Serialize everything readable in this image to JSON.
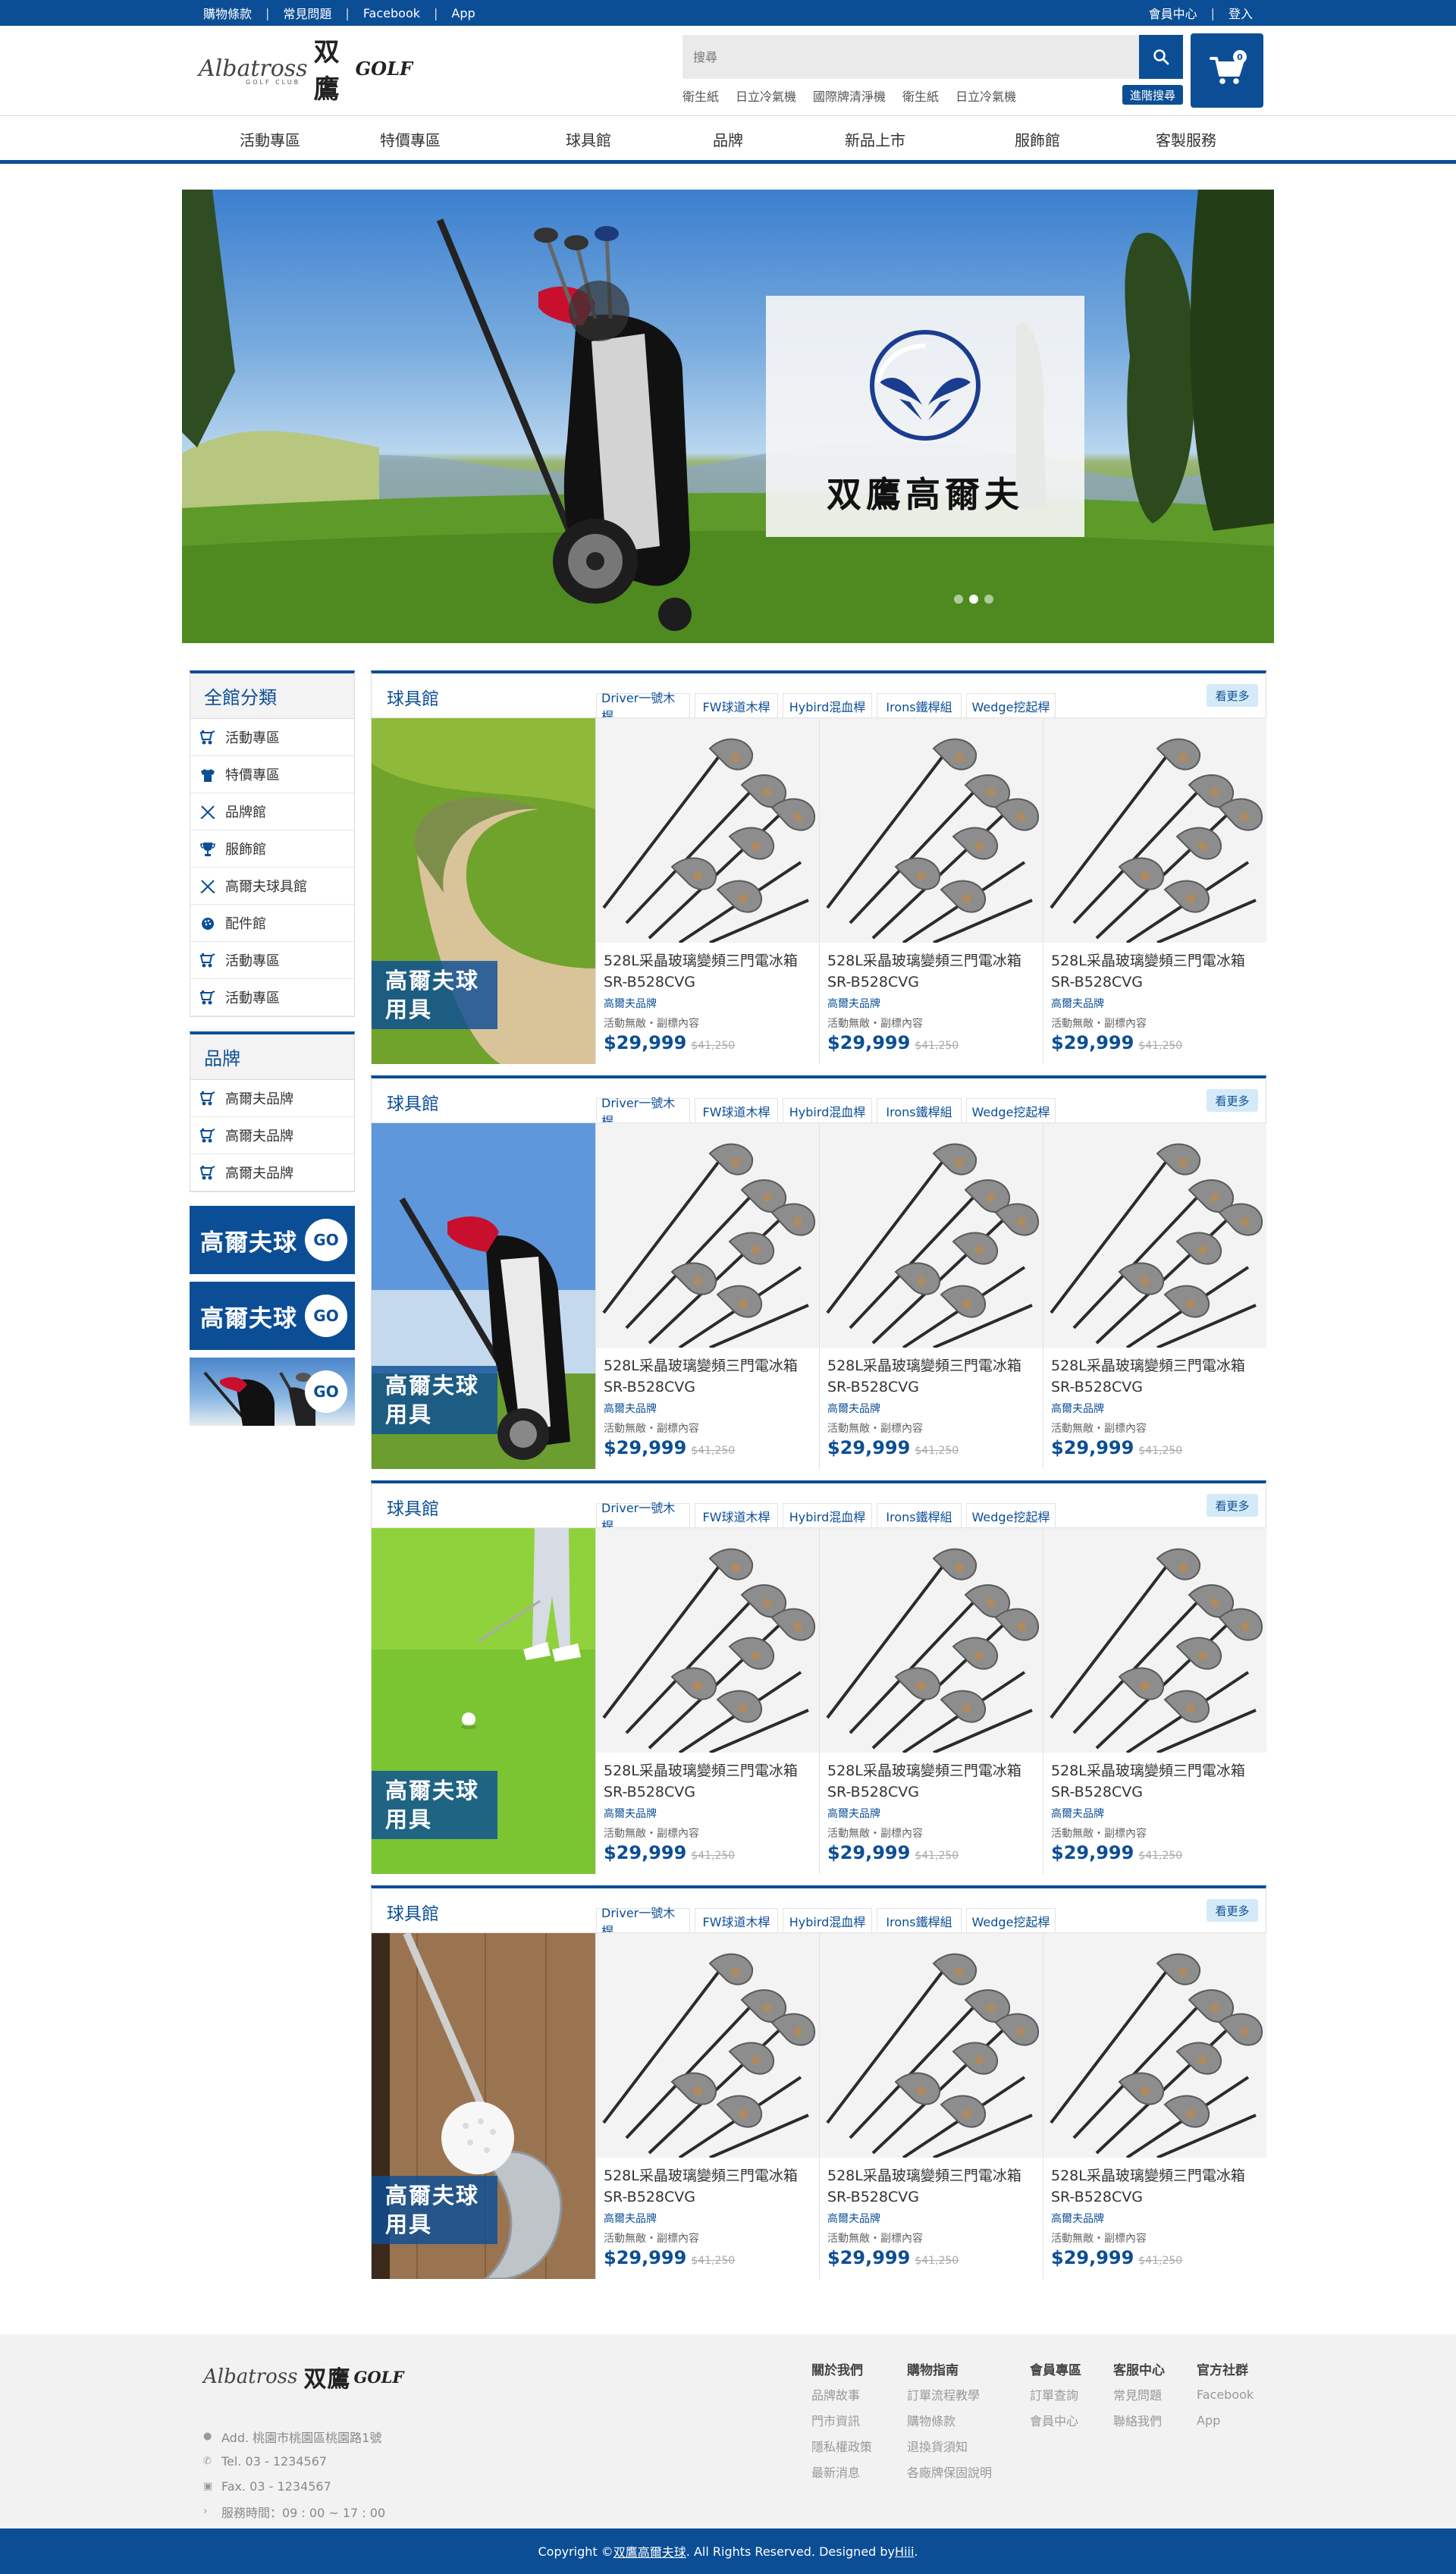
{
  "colors": {
    "primary": "#0c4e96",
    "accent_light": "#d5eaf8",
    "footer_bg": "#f2f2f2"
  },
  "topbar": {
    "left_links": [
      "購物條款",
      "常見問題",
      "Facebook",
      "App"
    ],
    "right_links": [
      "會員中心",
      "登入"
    ]
  },
  "header": {
    "logo_script": "Albatross",
    "logo_sub": "GOLF CLUB",
    "logo_cn": "双鷹",
    "logo_golf": "GOLF",
    "search_placeholder": "搜尋",
    "hot_keywords": [
      "衛生紙",
      "日立冷氣機",
      "國際牌清淨機",
      "衛生紙",
      "日立冷氣機"
    ],
    "advanced_search": "進階搜尋",
    "cart_count": "0"
  },
  "nav": [
    "活動專區",
    "特價專區",
    "球具館",
    "品牌",
    "新品上市",
    "服飾館",
    "客製服務"
  ],
  "banner": {
    "brand_cn": "双鷹高爾夫",
    "slide_count": 3,
    "active_slide": 2
  },
  "sidebar": {
    "categories_title": "全館分類",
    "categories": [
      {
        "label": "活動專區",
        "icon": "golf-cart-icon"
      },
      {
        "label": "特價專區",
        "icon": "shirt-icon"
      },
      {
        "label": "品牌館",
        "icon": "crossed-clubs-icon"
      },
      {
        "label": "服飾館",
        "icon": "trophy-icon"
      },
      {
        "label": "高爾夫球具館",
        "icon": "crossed-clubs-icon"
      },
      {
        "label": "配件館",
        "icon": "golf-ball-icon"
      },
      {
        "label": "活動專區",
        "icon": "golf-cart-icon"
      },
      {
        "label": "活動專區",
        "icon": "golf-cart-icon"
      }
    ],
    "brands_title": "品牌",
    "brands": [
      {
        "label": "高爾夫品牌",
        "icon": "golf-cart-icon"
      },
      {
        "label": "高爾夫品牌",
        "icon": "golf-cart-icon"
      },
      {
        "label": "高爾夫品牌",
        "icon": "golf-cart-icon"
      }
    ],
    "promos": [
      {
        "text": "高爾夫球",
        "go": "GO"
      },
      {
        "text": "高爾夫球",
        "go": "GO"
      },
      {
        "text": "",
        "go": "GO"
      }
    ]
  },
  "sections": [
    {
      "title": "球具館",
      "tabs": [
        "Driver一號木桿",
        "FW球道木桿",
        "Hybird混血桿",
        "Irons鐵桿組",
        "Wedge挖起桿"
      ],
      "more": "看更多",
      "feature_label": [
        "高爾夫球",
        "用具"
      ],
      "feature_scene": "bunker",
      "products": [
        {
          "name": "528L采晶玻璃變頻三門電冰箱 SR-B528CVG",
          "brand": "高爾夫品牌",
          "desc": "活動無敵・副標內容",
          "price": "$29,999",
          "old_price": "$41,250"
        },
        {
          "name": "528L采晶玻璃變頻三門電冰箱 SR-B528CVG",
          "brand": "高爾夫品牌",
          "desc": "活動無敵・副標內容",
          "price": "$29,999",
          "old_price": "$41,250"
        },
        {
          "name": "528L采晶玻璃變頻三門電冰箱 SR-B528CVG",
          "brand": "高爾夫品牌",
          "desc": "活動無敵・副標內容",
          "price": "$29,999",
          "old_price": "$41,250"
        }
      ]
    },
    {
      "title": "球具館",
      "tabs": [
        "Driver一號木桿",
        "FW球道木桿",
        "Hybird混血桿",
        "Irons鐵桿組",
        "Wedge挖起桿"
      ],
      "more": "看更多",
      "feature_label": [
        "高爾夫球",
        "用具"
      ],
      "feature_scene": "bag",
      "products": [
        {
          "name": "528L采晶玻璃變頻三門電冰箱 SR-B528CVG",
          "brand": "高爾夫品牌",
          "desc": "活動無敵・副標內容",
          "price": "$29,999",
          "old_price": "$41,250"
        },
        {
          "name": "528L采晶玻璃變頻三門電冰箱 SR-B528CVG",
          "brand": "高爾夫品牌",
          "desc": "活動無敵・副標內容",
          "price": "$29,999",
          "old_price": "$41,250"
        },
        {
          "name": "528L采晶玻璃變頻三門電冰箱 SR-B528CVG",
          "brand": "高爾夫品牌",
          "desc": "活動無敵・副標內容",
          "price": "$29,999",
          "old_price": "$41,250"
        }
      ]
    },
    {
      "title": "球具館",
      "tabs": [
        "Driver一號木桿",
        "FW球道木桿",
        "Hybird混血桿",
        "Irons鐵桿組",
        "Wedge挖起桿"
      ],
      "more": "看更多",
      "feature_label": [
        "高爾夫球",
        "用具"
      ],
      "feature_scene": "green",
      "products": [
        {
          "name": "528L采晶玻璃變頻三門電冰箱 SR-B528CVG",
          "brand": "高爾夫品牌",
          "desc": "活動無敵・副標內容",
          "price": "$29,999",
          "old_price": "$41,250"
        },
        {
          "name": "528L采晶玻璃變頻三門電冰箱 SR-B528CVG",
          "brand": "高爾夫品牌",
          "desc": "活動無敵・副標內容",
          "price": "$29,999",
          "old_price": "$41,250"
        },
        {
          "name": "528L采晶玻璃變頻三門電冰箱 SR-B528CVG",
          "brand": "高爾夫品牌",
          "desc": "活動無敵・副標內容",
          "price": "$29,999",
          "old_price": "$41,250"
        }
      ]
    },
    {
      "title": "球具館",
      "tabs": [
        "Driver一號木桿",
        "FW球道木桿",
        "Hybird混血桿",
        "Irons鐵桿組",
        "Wedge挖起桿"
      ],
      "more": "看更多",
      "feature_label": [
        "高爾夫球",
        "用具"
      ],
      "feature_scene": "wood",
      "products": [
        {
          "name": "528L采晶玻璃變頻三門電冰箱 SR-B528CVG",
          "brand": "高爾夫品牌",
          "desc": "活動無敵・副標內容",
          "price": "$29,999",
          "old_price": "$41,250"
        },
        {
          "name": "528L采晶玻璃變頻三門電冰箱 SR-B528CVG",
          "brand": "高爾夫品牌",
          "desc": "活動無敵・副標內容",
          "price": "$29,999",
          "old_price": "$41,250"
        },
        {
          "name": "528L采晶玻璃變頻三門電冰箱 SR-B528CVG",
          "brand": "高爾夫品牌",
          "desc": "活動無敵・副標內容",
          "price": "$29,999",
          "old_price": "$41,250"
        }
      ]
    }
  ],
  "footer": {
    "address": "Add. 桃園市桃園區桃園路1號",
    "tel": "Tel. 03 - 1234567",
    "fax": "Fax. 03 - 1234567",
    "hours": "服務時間：09 : 00 ~ 17 : 00",
    "columns": [
      {
        "title": "關於我們",
        "links": [
          "品牌故事",
          "門市資訊",
          "隱私權政策",
          "最新消息"
        ]
      },
      {
        "title": "購物指南",
        "links": [
          "訂單流程教學",
          "購物條款",
          "退換貨須知",
          "各廠牌保固說明"
        ]
      },
      {
        "title": "會員專區",
        "links": [
          "訂單查詢",
          "會員中心"
        ]
      },
      {
        "title": "客服中心",
        "links": [
          "常見問題",
          "聯絡我們"
        ]
      },
      {
        "title": "官方社群",
        "links": [
          "Facebook",
          "App"
        ]
      }
    ],
    "copyright_prefix": "Copyright © ",
    "copyright_brand": "双鷹高爾夫球",
    "copyright_middle": ". All Rights Reserved. Designed by ",
    "copyright_designer": "Hiii",
    "copyright_suffix": "."
  }
}
